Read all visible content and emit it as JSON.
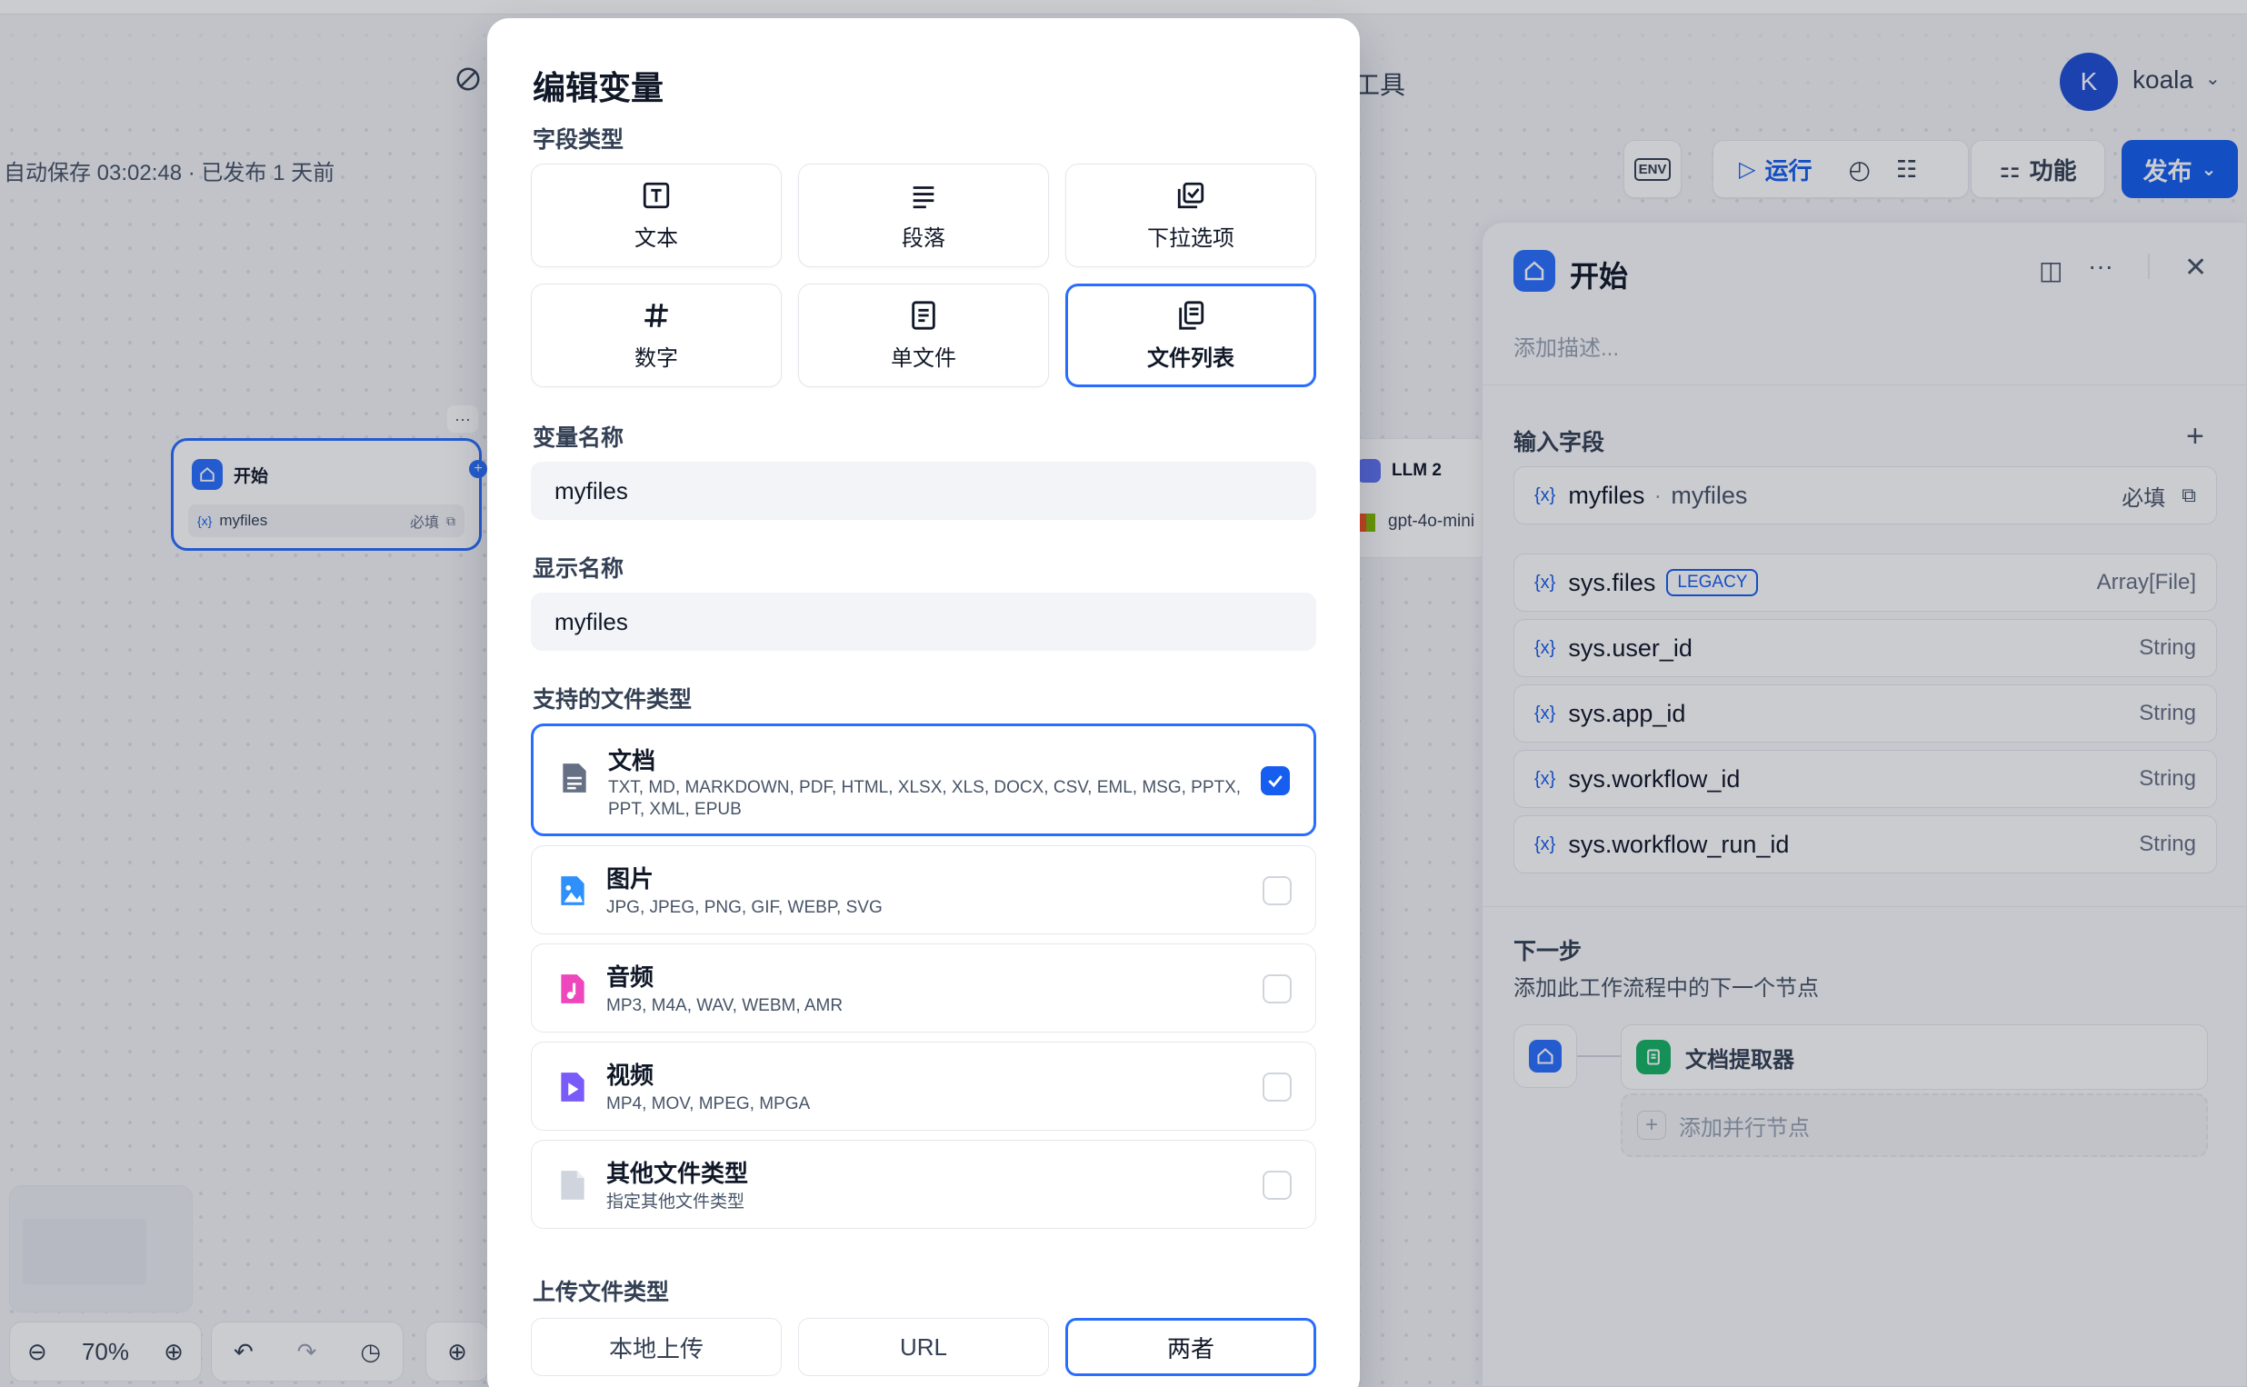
{
  "header": {
    "tools_label": "工具",
    "user_initial": "K",
    "user_name": "koala",
    "autosave": "自动保存 03:02:48 · 已发布 1 天前"
  },
  "toolbar": {
    "env_label": "ENV",
    "run_label": "运行",
    "features_label": "功能",
    "publish_label": "发布"
  },
  "canvas": {
    "start_node": {
      "title": "开始",
      "var_name": "myfiles",
      "required": "必填"
    },
    "llm_node": {
      "title": "LLM 2",
      "model": "gpt-4o-mini"
    },
    "zoom": "70%"
  },
  "modal": {
    "title": "编辑变量",
    "field_type_label": "字段类型",
    "field_types": [
      {
        "label": "文本",
        "icon": "text-icon",
        "selected": false
      },
      {
        "label": "段落",
        "icon": "paragraph-icon",
        "selected": false
      },
      {
        "label": "下拉选项",
        "icon": "select-icon",
        "selected": false
      },
      {
        "label": "数字",
        "icon": "number-icon",
        "selected": false
      },
      {
        "label": "单文件",
        "icon": "file-icon",
        "selected": false
      },
      {
        "label": "文件列表",
        "icon": "file-list-icon",
        "selected": true
      }
    ],
    "var_name_label": "变量名称",
    "var_name_value": "myfiles",
    "display_name_label": "显示名称",
    "display_name_value": "myfiles",
    "supported_types_label": "支持的文件类型",
    "file_types": [
      {
        "name": "文档",
        "exts": "TXT, MD, MARKDOWN, PDF, HTML, XLSX, XLS, DOCX, CSV, EML, MSG, PPTX, PPT, XML, EPUB",
        "checked": true,
        "color": "#667085"
      },
      {
        "name": "图片",
        "exts": "JPG, JPEG, PNG, GIF, WEBP, SVG",
        "checked": false,
        "color": "#2e90fa"
      },
      {
        "name": "音频",
        "exts": "MP3, M4A, WAV, WEBM, AMR",
        "checked": false,
        "color": "#ee46bc"
      },
      {
        "name": "视频",
        "exts": "MP4, MOV, MPEG, MPGA",
        "checked": false,
        "color": "#7a5af8"
      },
      {
        "name": "其他文件类型",
        "exts": "指定其他文件类型",
        "checked": false,
        "color": "#d0d5dd"
      }
    ],
    "upload_type_label": "上传文件类型",
    "upload_options": [
      {
        "label": "本地上传",
        "selected": false
      },
      {
        "label": "URL",
        "selected": false
      },
      {
        "label": "两者",
        "selected": true
      }
    ]
  },
  "panel": {
    "title": "开始",
    "description_placeholder": "添加描述...",
    "input_fields_label": "输入字段",
    "user_field": {
      "name": "myfiles",
      "sep": "·",
      "label": "myfiles",
      "required": "必填"
    },
    "sys_fields": [
      {
        "name": "sys.files",
        "badge": "LEGACY",
        "type": "Array[File]"
      },
      {
        "name": "sys.user_id",
        "badge": "",
        "type": "String"
      },
      {
        "name": "sys.app_id",
        "badge": "",
        "type": "String"
      },
      {
        "name": "sys.workflow_id",
        "badge": "",
        "type": "String"
      },
      {
        "name": "sys.workflow_run_id",
        "badge": "",
        "type": "String"
      }
    ],
    "next_step_label": "下一步",
    "next_step_desc": "添加此工作流程中的下一个节点",
    "next_node": "文档提取器",
    "add_parallel": "添加并行节点"
  },
  "colors": {
    "accent": "#155eef",
    "selected_border": "#296dff"
  }
}
